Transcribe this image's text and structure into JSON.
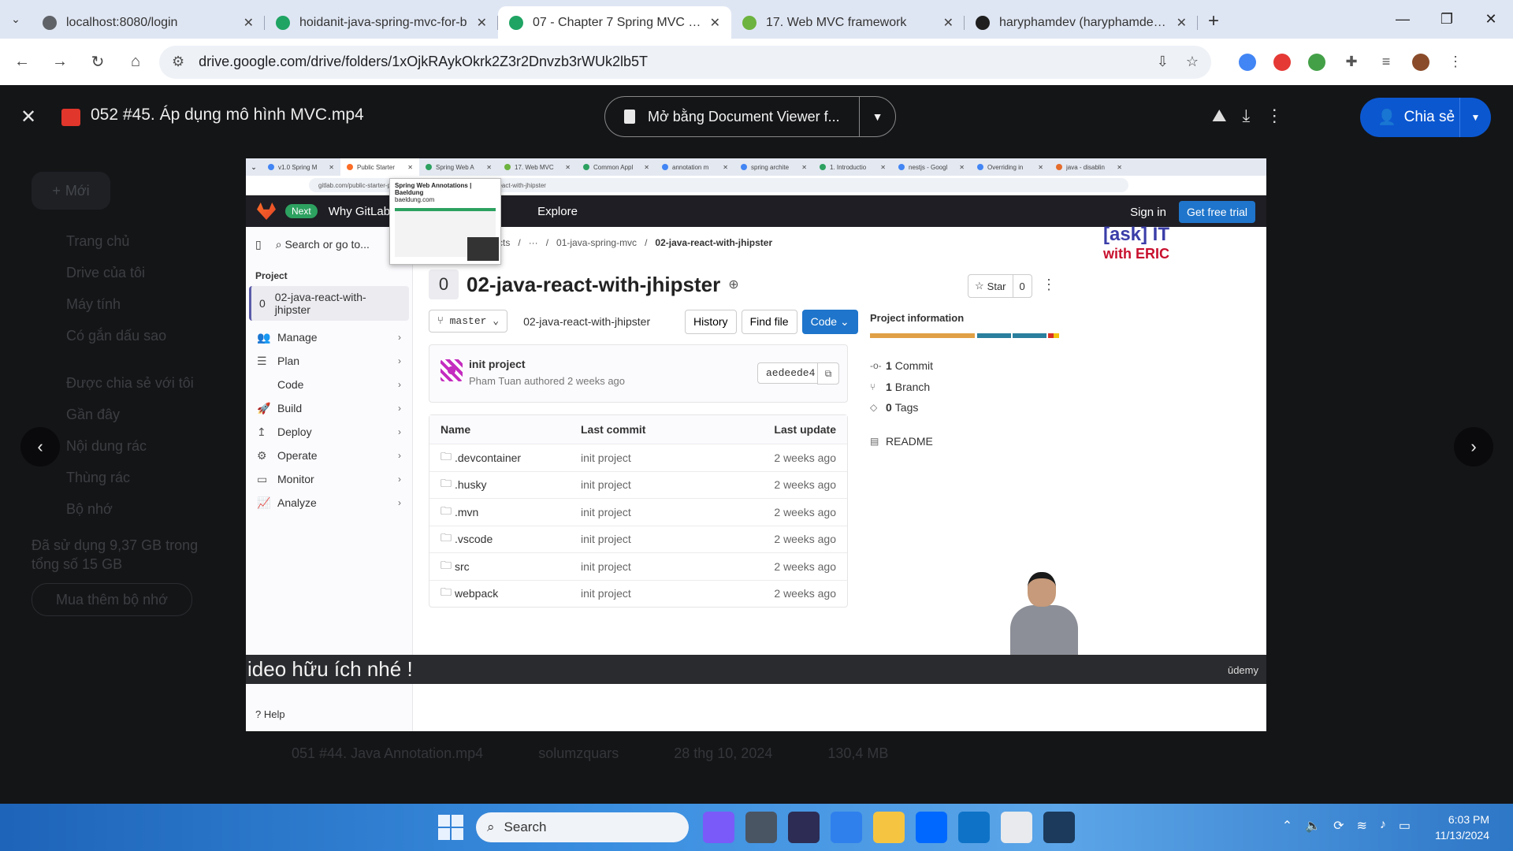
{
  "browser": {
    "tabs": [
      {
        "title": "localhost:8080/login",
        "favicon_color": "#5f6368",
        "active": false
      },
      {
        "title": "hoidanit-java-spring-mvc-for-b",
        "favicon_color": "#1fa463",
        "active": false
      },
      {
        "title": "07 - Chapter 7 Spring MVC - Go",
        "favicon_color": "#1fa463",
        "active": true
      },
      {
        "title": "17. Web MVC framework",
        "favicon_color": "#6db33f",
        "active": false
      },
      {
        "title": "haryphamdev (haryphamdev) /",
        "favicon_color": "#1f1f1f",
        "active": false
      }
    ],
    "url": "drive.google.com/drive/folders/1xOjkRAykOkrk2Z3r2Dnvzb3rWUk2lb5T"
  },
  "viewer": {
    "file_title": "052 #45. Áp dụng mô hình MVC.mp4",
    "open_with_label": "Mở bằng Document Viewer f...",
    "share_label": "Chia sẻ"
  },
  "drive_bg": {
    "left_items": [
      "Mới",
      "Trang chủ",
      "Drive của tôi",
      "Máy tính",
      "Có gắn dấu sao",
      "Được chia sẻ với tôi",
      "Gần đây",
      "Nội dung rác",
      "Thùng rác",
      "Bộ nhớ"
    ],
    "storage_text": "Đã sử dụng 9,37 GB trong tổng số 15 GB",
    "buy_storage": "Mua thêm bộ nhớ",
    "row_name": "051 #44. Java Annotation.mp4",
    "row_owner": "solumzquars",
    "row_date": "28 thg 10, 2024",
    "row_size": "130,4 MB"
  },
  "video": {
    "inner_tabs": [
      "v1.0 Spring M",
      "Public Starter",
      "Spring Web A",
      "17. Web MVC",
      "Common Appl",
      "annotation m",
      "spring archite",
      "1. Introductio",
      "nestjs - Googl",
      "Overriding in",
      "java - disablin"
    ],
    "inner_url": "gitlab.com/public-starter-pr",
    "inner_url_tail": "va-react-with-jhipster",
    "preview_title": "Spring Web Annotations | Baeldung",
    "preview_domain": "baeldung.com",
    "gitlab": {
      "next": "Next",
      "nav": [
        "Why GitLab",
        "Pr",
        "Explore"
      ],
      "sign_in": "Sign in",
      "free_trial": "Get free trial",
      "search": "Search or go to...",
      "project_label": "Project",
      "project_avatar": "0",
      "project_name": "02-java-react-with-jhipster",
      "menu": [
        "Manage",
        "Plan",
        "Code",
        "Build",
        "Deploy",
        "Operate",
        "Monitor",
        "Analyze"
      ],
      "help": "Help",
      "crumbs": [
        "cts",
        "···",
        "01-java-spring-mvc",
        "02-java-react-with-jhipster"
      ],
      "branch": "master",
      "path": "02-java-react-with-jhipster",
      "history": "History",
      "find_file": "Find file",
      "code": "Code",
      "star": "Star",
      "star_count": "0",
      "commit_msg": "init project",
      "commit_author": "Pham Tuan authored 2 weeks ago",
      "commit_sha": "aedeede4",
      "table_headers": [
        "Name",
        "Last commit",
        "Last update"
      ],
      "files": [
        {
          "name": ".devcontainer",
          "commit": "init project",
          "updated": "2 weeks ago"
        },
        {
          "name": ".husky",
          "commit": "init project",
          "updated": "2 weeks ago"
        },
        {
          "name": ".mvn",
          "commit": "init project",
          "updated": "2 weeks ago"
        },
        {
          "name": ".vscode",
          "commit": "init project",
          "updated": "2 weeks ago"
        },
        {
          "name": "src",
          "commit": "init project",
          "updated": "2 weeks ago"
        },
        {
          "name": "webpack",
          "commit": "init project",
          "updated": "2 weeks ago"
        }
      ],
      "info_title": "Project information",
      "commits": "1",
      "commits_label": "Commit",
      "branches": "1",
      "branches_label": "Branch",
      "tags": "0",
      "tags_label": "Tags",
      "readme": "README"
    },
    "watermark_line1": "[ask] IT",
    "watermark_line2": "with ERIC",
    "caption": "ideo hữu ích nhé !",
    "udemy": "ūdemy"
  },
  "taskbar": {
    "search": "Search",
    "time": "6:03 PM",
    "date": "11/13/2024"
  }
}
